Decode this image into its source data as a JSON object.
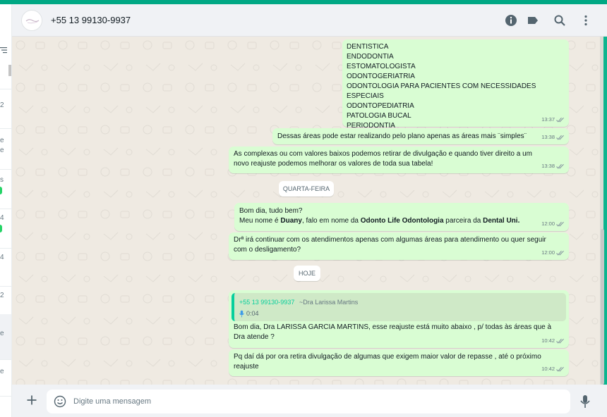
{
  "header": {
    "contact_name": "+55 13 99130-9937"
  },
  "sidebar_fragments": [
    "2",
    "2",
    "e",
    "e",
    "s",
    "4",
    "4",
    "2",
    "e",
    "e"
  ],
  "messages": {
    "specialties": {
      "lines": [
        "DENTISTICA",
        "ENDODONTIA",
        "ESTOMATOLOGISTA",
        "ODONTOGERIATRIA",
        "ODONTOLOGIA PARA PACIENTES COM NECESSIDADES ESPECIAIS",
        "ODONTOPEDIATRIA",
        "PATOLOGIA BUCAL",
        "PERIODONTIA"
      ],
      "time": "13:37"
    },
    "m2": {
      "text": "Dessas áreas pode estar realizando pelo plano apenas as áreas mais ¨simples¨",
      "time": "13:38"
    },
    "m3": {
      "line1": "As complexas ou com valores baixos podemos retirar de divulgação e quando tiver direito a um",
      "line2": "novo reajuste podemos melhorar os valores de toda sua tabela!",
      "time": "13:38"
    },
    "date1": "QUARTA-FEIRA",
    "m4": {
      "line1": "Bom dia, tudo bem?",
      "p1": "Meu nome é ",
      "name": "Duany",
      "p2": ", falo em nome da ",
      "company": "Odonto Life Odontologia",
      "p3": " parceira da ",
      "partner": "Dental Uni.",
      "time": "12:00"
    },
    "m5": {
      "line1": "Drª irá continuar com os atendimentos apenas com algumas áreas para atendimento ou quer seguir",
      "line2": "com o desligamento?",
      "time": "12:00"
    },
    "date2": "HOJE",
    "m6": {
      "quote_name": "+55 13 99130-9937",
      "quote_author": "~Dra Larissa Martins",
      "quote_audio": "0:04",
      "line1": "Bom dia, Dra LARISSA GARCIA MARTINS, esse reajuste está muito abaixo , p/ todas às áreas que à",
      "line2": "Dra atende ?",
      "time": "10:42"
    },
    "m7": {
      "line1": "Pq daí dá por ora retira divulgação de algumas que exigem maior valor de repasse , até o próximo",
      "line2": "reajuste",
      "time": "10:42"
    }
  },
  "composer": {
    "placeholder": "Digite uma mensagem"
  },
  "colors": {
    "accent": "#00a884",
    "bubble_out": "#d9fdd3",
    "read_ticks": "#8696a0"
  },
  "icons": [
    "info-icon",
    "label-icon",
    "search-icon",
    "menu-icon",
    "plus-icon",
    "emoji-icon",
    "mic-icon",
    "mic-small-icon",
    "double-check-icon",
    "filter-icon"
  ]
}
